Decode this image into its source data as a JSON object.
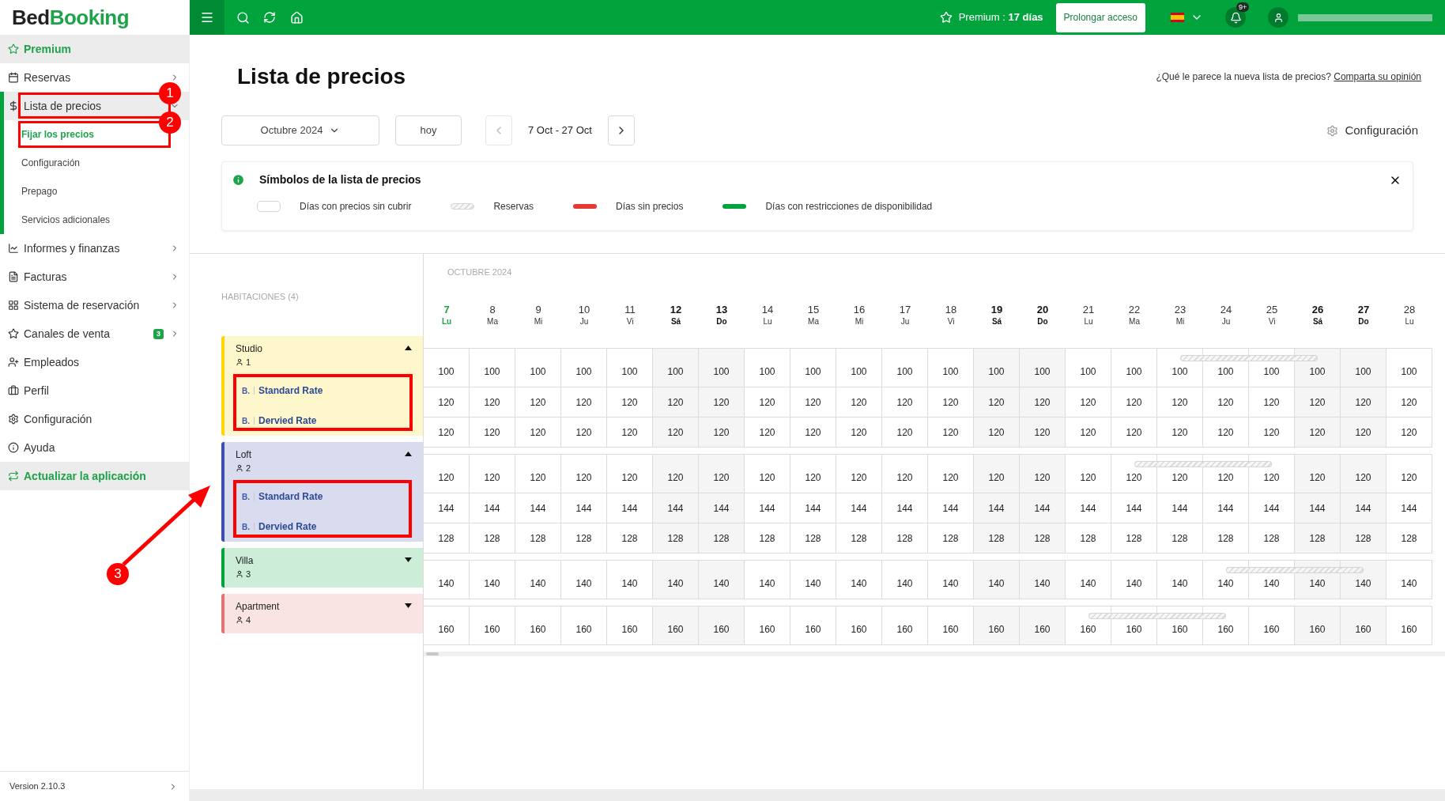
{
  "topbar": {
    "premium": "Premium : **17 días**",
    "extend_button": "Prolongar acceso",
    "notifications_badge": "9+"
  },
  "sidebar": {
    "logo_dark": "Bed",
    "logo_green": "Booking",
    "items": [
      {
        "label": "Premium",
        "kind": "promo"
      },
      {
        "label": "Reservas",
        "kind": "nav",
        "submenu": true,
        "expanded": false
      },
      {
        "label": "Lista de precios",
        "kind": "nav",
        "submenu": true,
        "expanded": true,
        "children": [
          {
            "label": "Fijar los precios",
            "selected": true
          },
          {
            "label": "Configuración",
            "selected": false
          },
          {
            "label": "Prepago",
            "selected": false
          },
          {
            "label": "Servicios adicionales",
            "selected": false
          }
        ]
      },
      {
        "label": "Informes y finanzas",
        "kind": "nav",
        "submenu": true,
        "expanded": false
      },
      {
        "label": "Facturas",
        "kind": "nav",
        "submenu": true,
        "expanded": false
      },
      {
        "label": "Sistema de reservación",
        "kind": "nav",
        "submenu": true,
        "expanded": false
      },
      {
        "label": "Canales de venta",
        "kind": "nav",
        "submenu": true,
        "expanded": false,
        "badge": "3"
      },
      {
        "label": "Empleados",
        "kind": "nav",
        "submenu": false
      },
      {
        "label": "Perfil",
        "kind": "nav",
        "submenu": false
      },
      {
        "label": "Configuración",
        "kind": "nav",
        "submenu": false
      },
      {
        "label": "Ayuda",
        "kind": "nav",
        "submenu": false
      },
      {
        "label": "Actualizar la aplicación",
        "kind": "promo"
      }
    ],
    "version": "Version 2.10.3"
  },
  "page": {
    "title": "Lista de precios",
    "feedback_text": "¿Qué le parece la nueva lista de precios?",
    "feedback_link": "Comparta su opinión",
    "month_select": "Octubre 2024",
    "today_button": "hoy",
    "range": "7 Oct - 27 Oct",
    "settings_button": "Configuración"
  },
  "legend": {
    "title": "Símbolos de la lista de precios",
    "items": [
      {
        "kind": "empty",
        "label": "Días con precios sin cubrir"
      },
      {
        "kind": "hatched",
        "label": "Reservas"
      },
      {
        "kind": "bar",
        "color": "#e53935",
        "label": "Días sin precios"
      },
      {
        "kind": "bar",
        "color": "#00a33c",
        "label": "Días con restricciones de disponibilidad"
      }
    ]
  },
  "grid": {
    "month": "OCTUBRE 2024",
    "rooms_heading": "HABITACIONES (4)",
    "days": [
      {
        "day": "7",
        "weekday": "Lu",
        "weekend": false,
        "today": true
      },
      {
        "day": "8",
        "weekday": "Ma",
        "weekend": false,
        "today": false
      },
      {
        "day": "9",
        "weekday": "Mi",
        "weekend": false,
        "today": false
      },
      {
        "day": "10",
        "weekday": "Ju",
        "weekend": false,
        "today": false
      },
      {
        "day": "11",
        "weekday": "Vi",
        "weekend": false,
        "today": false
      },
      {
        "day": "12",
        "weekday": "Sá",
        "weekend": true,
        "today": false
      },
      {
        "day": "13",
        "weekday": "Do",
        "weekend": true,
        "today": false
      },
      {
        "day": "14",
        "weekday": "Lu",
        "weekend": false,
        "today": false
      },
      {
        "day": "15",
        "weekday": "Ma",
        "weekend": false,
        "today": false
      },
      {
        "day": "16",
        "weekday": "Mi",
        "weekend": false,
        "today": false
      },
      {
        "day": "17",
        "weekday": "Ju",
        "weekend": false,
        "today": false
      },
      {
        "day": "18",
        "weekday": "Vi",
        "weekend": false,
        "today": false
      },
      {
        "day": "19",
        "weekday": "Sá",
        "weekend": true,
        "today": false
      },
      {
        "day": "20",
        "weekday": "Do",
        "weekend": true,
        "today": false
      },
      {
        "day": "21",
        "weekday": "Lu",
        "weekend": false,
        "today": false
      },
      {
        "day": "22",
        "weekday": "Ma",
        "weekend": false,
        "today": false
      },
      {
        "day": "23",
        "weekday": "Mi",
        "weekend": false,
        "today": false
      },
      {
        "day": "24",
        "weekday": "Ju",
        "weekend": false,
        "today": false
      },
      {
        "day": "25",
        "weekday": "Vi",
        "weekend": false,
        "today": false
      },
      {
        "day": "26",
        "weekday": "Sá",
        "weekend": true,
        "today": false
      },
      {
        "day": "27",
        "weekday": "Do",
        "weekend": true,
        "today": false
      },
      {
        "day": "28",
        "weekday": "Lu",
        "weekend": false,
        "today": false
      }
    ],
    "rooms": [
      {
        "name": "Studio",
        "guests": "1",
        "color": "#ffd600",
        "expanded": true,
        "booked": [
          false,
          false,
          false,
          false,
          false,
          false,
          false,
          false,
          false,
          false,
          false,
          false,
          false,
          false,
          false,
          false,
          true,
          true,
          true,
          true,
          false,
          false
        ],
        "prices": [
          "100",
          "100",
          "100",
          "100",
          "100",
          "100",
          "100",
          "100",
          "100",
          "100",
          "100",
          "100",
          "100",
          "100",
          "100",
          "100",
          "100",
          "100",
          "100",
          "100",
          "100",
          "100"
        ],
        "rates": [
          {
            "mark": "B.",
            "label": "Standard Rate",
            "prices": [
              "120",
              "120",
              "120",
              "120",
              "120",
              "120",
              "120",
              "120",
              "120",
              "120",
              "120",
              "120",
              "120",
              "120",
              "120",
              "120",
              "120",
              "120",
              "120",
              "120",
              "120",
              "120"
            ]
          },
          {
            "mark": "B.",
            "label": "Dervied Rate",
            "prices": [
              "120",
              "120",
              "120",
              "120",
              "120",
              "120",
              "120",
              "120",
              "120",
              "120",
              "120",
              "120",
              "120",
              "120",
              "120",
              "120",
              "120",
              "120",
              "120",
              "120",
              "120",
              "120"
            ]
          }
        ]
      },
      {
        "name": "Loft",
        "guests": "2",
        "color": "#3f4db0",
        "expanded": true,
        "booked": [
          false,
          false,
          false,
          false,
          false,
          false,
          false,
          false,
          false,
          false,
          false,
          false,
          false,
          false,
          false,
          true,
          true,
          true,
          true,
          false,
          false,
          false
        ],
        "prices": [
          "120",
          "120",
          "120",
          "120",
          "120",
          "120",
          "120",
          "120",
          "120",
          "120",
          "120",
          "120",
          "120",
          "120",
          "120",
          "120",
          "120",
          "120",
          "120",
          "120",
          "120",
          "120"
        ],
        "rates": [
          {
            "mark": "B.",
            "label": "Standard Rate",
            "prices": [
              "144",
              "144",
              "144",
              "144",
              "144",
              "144",
              "144",
              "144",
              "144",
              "144",
              "144",
              "144",
              "144",
              "144",
              "144",
              "144",
              "144",
              "144",
              "144",
              "144",
              "144",
              "144"
            ]
          },
          {
            "mark": "B.",
            "label": "Dervied Rate",
            "prices": [
              "128",
              "128",
              "128",
              "128",
              "128",
              "128",
              "128",
              "128",
              "128",
              "128",
              "128",
              "128",
              "128",
              "128",
              "128",
              "128",
              "128",
              "128",
              "128",
              "128",
              "128",
              "128"
            ]
          }
        ]
      },
      {
        "name": "Villa",
        "guests": "3",
        "color": "#00a33c",
        "expanded": false,
        "booked": [
          false,
          false,
          false,
          false,
          false,
          false,
          false,
          false,
          false,
          false,
          false,
          false,
          false,
          false,
          false,
          false,
          false,
          true,
          true,
          true,
          true,
          false
        ],
        "prices": [
          "140",
          "140",
          "140",
          "140",
          "140",
          "140",
          "140",
          "140",
          "140",
          "140",
          "140",
          "140",
          "140",
          "140",
          "140",
          "140",
          "140",
          "140",
          "140",
          "140",
          "140",
          "140"
        ]
      },
      {
        "name": "Apartment",
        "guests": "4",
        "color": "#e57373",
        "expanded": false,
        "booked": [
          false,
          false,
          false,
          false,
          false,
          false,
          false,
          false,
          false,
          false,
          false,
          false,
          false,
          false,
          true,
          true,
          true,
          true,
          false,
          false,
          false,
          false
        ],
        "prices": [
          "160",
          "160",
          "160",
          "160",
          "160",
          "160",
          "160",
          "160",
          "160",
          "160",
          "160",
          "160",
          "160",
          "160",
          "160",
          "160",
          "160",
          "160",
          "160",
          "160",
          "160",
          "160"
        ]
      }
    ]
  },
  "annotations": [
    {
      "label": "1"
    },
    {
      "label": "2"
    },
    {
      "label": "3"
    }
  ]
}
